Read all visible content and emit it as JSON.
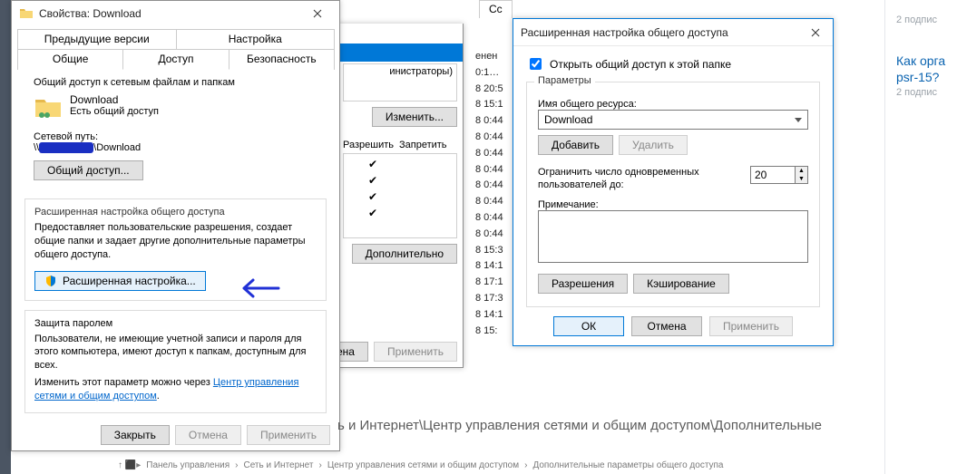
{
  "properties": {
    "title": "Свойства: Download",
    "tabs_row1": [
      "Предыдущие версии",
      "Настройка"
    ],
    "tabs_row2": [
      "Общие",
      "Доступ",
      "Безопасность"
    ],
    "active_tab": "Доступ",
    "network_group_title": "Общий доступ к сетевым файлам и папкам",
    "folder_name": "Download",
    "shared_status": "Есть общий доступ",
    "network_path_label": "Сетевой путь:",
    "network_path_suffix": "Download",
    "share_button": "Общий доступ...",
    "advanced_group_title": "Расширенная настройка общего доступа",
    "advanced_desc": "Предоставляет пользовательские разрешения, создает общие папки и задает другие дополнительные параметры общего доступа.",
    "advanced_btn": "Расширенная настройка...",
    "password_group_title": "Защита паролем",
    "password_desc": "Пользователи, не имеющие учетной записи и пароля для этого компьютера, имеют доступ к папкам, доступным для всех.",
    "password_change_prefix": "Изменить этот параметр можно через ",
    "password_link": "Центр управления сетями и общим доступом",
    "footer": {
      "close": "Закрыть",
      "cancel": "Отмена",
      "apply": "Применить"
    }
  },
  "permwin": {
    "bluebar_text": "",
    "group_label": "инистраторы)",
    "change_btn": "Изменить...",
    "col_allow": "Разрешить",
    "col_deny": "Запретить",
    "extra_btn": "Дополнительно",
    "footer_cancel": "Отмена",
    "footer_apply": "Применить",
    "rows": [
      true,
      true,
      true,
      true
    ]
  },
  "times": [
    "енен",
    "0:1…",
    "8 20:5",
    "8 15:1",
    "8 0:44",
    "8 0:44",
    "8 0:44",
    "8 0:44",
    "8 0:44",
    "8 0:44",
    "8 0:44",
    "8 0:44",
    "8 15:3",
    "8 14:1",
    "8 17:1",
    "8 17:3",
    "8 14:1",
    "8 15:"
  ],
  "adv": {
    "title": "Расширенная настройка общего доступа",
    "open_share_chk": "Открыть общий доступ к этой папке",
    "params_label": "Параметры",
    "share_name_label": "Имя общего ресурса:",
    "share_name_value": "Download",
    "add_btn": "Добавить",
    "del_btn": "Удалить",
    "limit_label_1": "Ограничить число одновременных",
    "limit_label_2": "пользователей до:",
    "limit_value": "20",
    "note_label": "Примечание:",
    "perm_btn": "Разрешения",
    "cache_btn": "Кэширование",
    "footer": {
      "ok": "ОК",
      "cancel": "Отмена",
      "apply": "Применить"
    }
  },
  "right": {
    "sub_top": "2 подпис",
    "q1": "Как орга",
    "q2": "psr-15?",
    "sub2": "2 подпис"
  },
  "fragments": {
    "sc_tab": "Сс",
    "long_path": "ь и Интернет\\Центр управления сетями и общим доступом\\Дополнительные"
  },
  "breadcrumb": [
    "Панель управления",
    "Сеть и Интернет",
    "Центр управления сетями и общим доступом",
    "Дополнительные параметры общего доступа"
  ]
}
